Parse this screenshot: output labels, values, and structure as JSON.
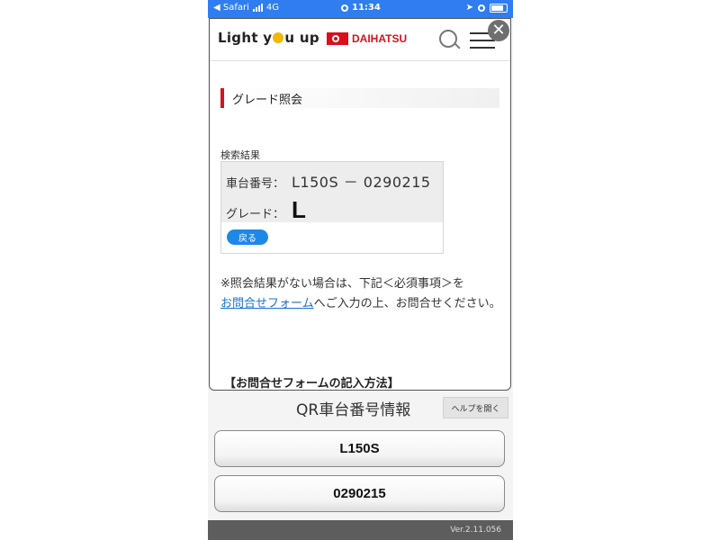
{
  "status_bar": {
    "carrier_back": "◀ Safari",
    "network": "4G",
    "time": "11:34"
  },
  "site": {
    "logo_part1": "Light y",
    "logo_part2": "u up",
    "brand": "DAIHATSU"
  },
  "page": {
    "heading": "グレード照会",
    "result_label": "検索結果",
    "chassis_key": "車台番号：",
    "chassis_value": "L150S － 0290215",
    "grade_key": "グレード：",
    "grade_value": "L",
    "back_label": "戻る",
    "note_before": "※照会結果がない場合は、下記＜必須事項＞を",
    "note_link": "お問合せフォーム",
    "note_after": "へご入力の上、お問合せください。",
    "form_heading": "【お問合せフォームの記入方法】"
  },
  "app": {
    "qr_title": "QR車台番号情報",
    "help_label": "ヘルプを開く",
    "model_button": "L150S",
    "serial_button": "0290215",
    "version": "Ver.2.11.056"
  },
  "colors": {
    "status_bar": "#2f7df0",
    "brand_red": "#d9101c",
    "link_blue": "#1a73c8"
  }
}
